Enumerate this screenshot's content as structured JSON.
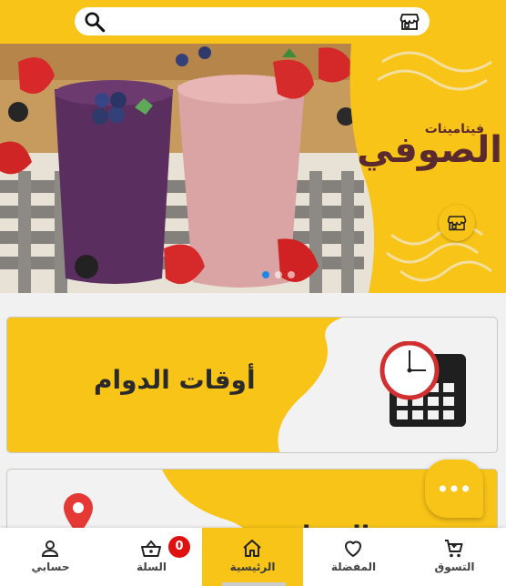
{
  "search": {
    "placeholder": "",
    "value": ""
  },
  "banner": {
    "brand_small": "فيتامينات",
    "brand_large": "الصوفي",
    "slides_count": 3,
    "active_slide": 1
  },
  "cards": {
    "hours": {
      "title": "أوقات الدوام"
    },
    "location": {
      "title": "العنوان"
    }
  },
  "bottom_nav": {
    "items": [
      {
        "label": "حسابي",
        "icon": "person-icon"
      },
      {
        "label": "السلة",
        "icon": "basket-icon",
        "badge": "0"
      },
      {
        "label": "الرئيسية",
        "icon": "home-icon",
        "active": true
      },
      {
        "label": "المفضلة",
        "icon": "heart-icon"
      },
      {
        "label": "التسوق",
        "icon": "cart-icon"
      }
    ]
  },
  "colors": {
    "accent": "#f8c417",
    "text_dark": "#2b2a2a",
    "badge": "#e01010",
    "dot_active": "#1e88e5"
  }
}
